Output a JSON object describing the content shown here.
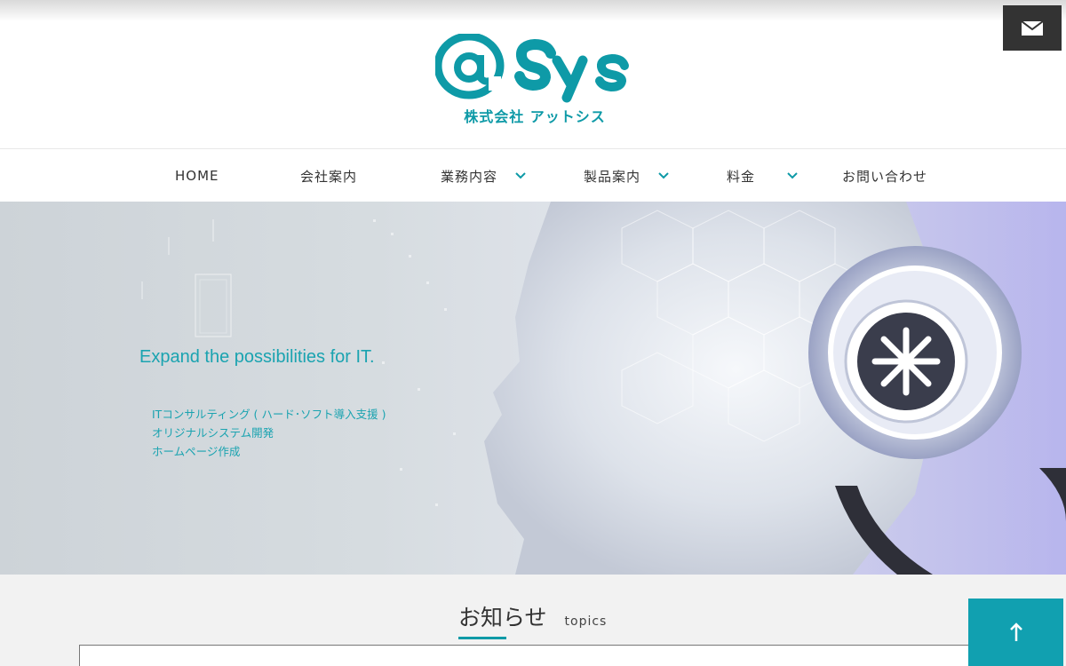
{
  "logo": {
    "mark_text": "@ Sys",
    "company_name": "株式会社 アットシス"
  },
  "header": {
    "mail_icon": "mail-icon"
  },
  "nav": {
    "items": [
      {
        "label": "HOME",
        "has_dropdown": false
      },
      {
        "label": "会社案内",
        "has_dropdown": false
      },
      {
        "label": "業務内容",
        "has_dropdown": true
      },
      {
        "label": "製品案内",
        "has_dropdown": true
      },
      {
        "label": "料金",
        "has_dropdown": true
      },
      {
        "label": "お問い合わせ",
        "has_dropdown": false
      }
    ]
  },
  "hero": {
    "tagline": "Expand the possibilities for IT.",
    "services": [
      "ITコンサルティング ( ハード･ソフト導入支援 )",
      "オリジナルシステム開発",
      "ホームページ作成"
    ]
  },
  "topics": {
    "title_jp": "お知らせ",
    "title_en": "topics"
  },
  "colors": {
    "accent": "#0e9aa7",
    "dark": "#333333",
    "to_top_bg": "#11a0b0"
  },
  "to_top": {
    "label": "↑"
  }
}
